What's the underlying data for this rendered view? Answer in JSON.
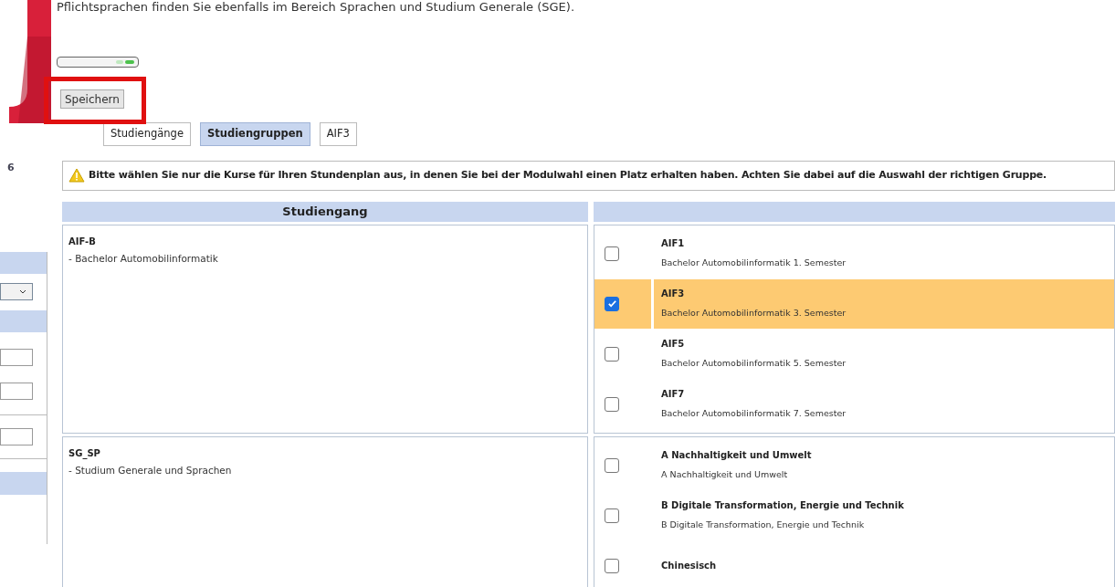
{
  "notice_top": "Pflichtsprachen finden Sie ebenfalls im Bereich Sprachen und Studium Generale (SGE).",
  "save_button": "Speichern",
  "tabs": [
    {
      "label": "Studiengänge",
      "selected": false
    },
    {
      "label": "Studiengruppen",
      "selected": true
    },
    {
      "label": "AIF3",
      "selected": false
    }
  ],
  "sidebar": {
    "label": "6"
  },
  "warning": "Bitte wählen Sie nur die Kurse für Ihren Stundenplan aus, in denen Sie bei der Modulwahl einen Platz erhalten haben. Achten Sie dabei auf die Auswahl der richtigen Gruppe.",
  "table": {
    "columns": [
      "Studiengang"
    ],
    "rows": [
      {
        "code": "AIF-B",
        "name": "- Bachelor Automobilinformatik",
        "groups": [
          {
            "title": "AIF1",
            "subtitle": "Bachelor Automobilinformatik 1. Semester",
            "checked": false
          },
          {
            "title": "AIF3",
            "subtitle": "Bachelor Automobilinformatik 3. Semester",
            "checked": true
          },
          {
            "title": "AIF5",
            "subtitle": "Bachelor Automobilinformatik 5. Semester",
            "checked": false
          },
          {
            "title": "AIF7",
            "subtitle": "Bachelor Automobilinformatik 7. Semester",
            "checked": false
          }
        ]
      },
      {
        "code": "SG_SP",
        "name": "- Studium Generale und Sprachen",
        "groups": [
          {
            "title": "A Nachhaltigkeit und Umwelt",
            "subtitle": "A Nachhaltigkeit und Umwelt",
            "checked": false
          },
          {
            "title": "B Digitale Transformation, Energie und Technik",
            "subtitle": "B Digitale Transformation, Energie und Technik",
            "checked": false
          },
          {
            "title": "Chinesisch",
            "checked": false
          }
        ]
      }
    ]
  }
}
